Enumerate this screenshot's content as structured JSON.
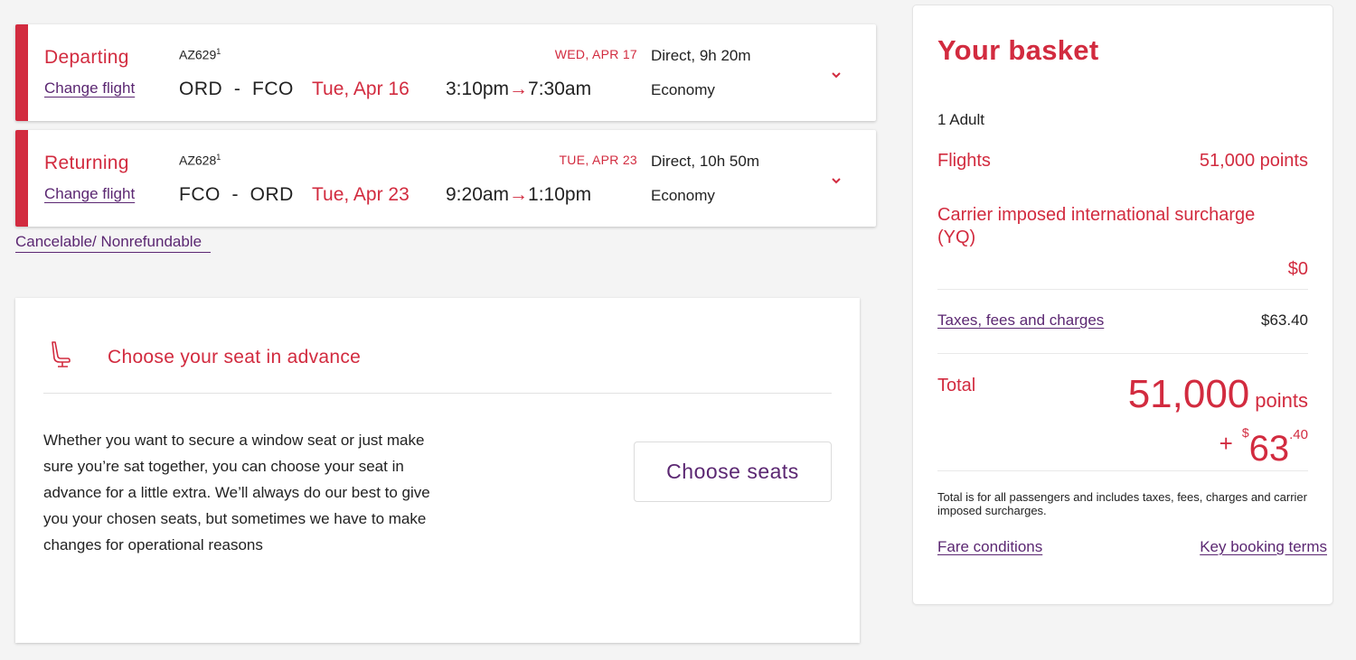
{
  "flights": [
    {
      "direction": "Departing",
      "change_label": "Change flight",
      "flight_number": "AZ629",
      "flight_note_marker": "1",
      "origin": "ORD",
      "destination": "FCO",
      "route_separator": "-",
      "departure_date": "Tue, Apr 16",
      "departure_time": "3:10pm",
      "arrival_time": "7:30am",
      "arrow": "→",
      "arrival_date": "WED, APR 17",
      "duration": "Direct, 9h 20m",
      "cabin": "Economy",
      "expand_icon": "chevron-down-icon"
    },
    {
      "direction": "Returning",
      "change_label": "Change flight",
      "flight_number": "AZ628",
      "flight_note_marker": "1",
      "origin": "FCO",
      "destination": "ORD",
      "route_separator": "-",
      "departure_date": "Tue, Apr 23",
      "departure_time": "9:20am",
      "arrival_time": "1:10pm",
      "arrow": "→",
      "arrival_date": "TUE, APR 23",
      "duration": "Direct, 10h 50m",
      "cabin": "Economy",
      "expand_icon": "chevron-down-icon"
    }
  ],
  "fare_policy_link": "Cancelable/ Nonrefundable",
  "seat_selection": {
    "icon": "seat-icon",
    "title": "Choose your seat in advance",
    "description": "Whether you want to secure a window seat or just make sure you’re sat together, you can choose your seat in advance for a little extra. We’ll always do our best to give you your chosen seats, but sometimes we have to make changes for operational reasons",
    "button_label": "Choose seats"
  },
  "basket": {
    "title": "Your basket",
    "passengers": "1 Adult",
    "flights_label": "Flights",
    "flights_value": "51,000 points",
    "surcharge_label": "Carrier imposed international surcharge (YQ)",
    "surcharge_value": "$0",
    "taxes_label": "Taxes, fees and charges",
    "taxes_value": "$63.40",
    "total_label": "Total",
    "total_points": "51,000",
    "total_points_unit": "points",
    "total_plus": "+",
    "total_currency": "$",
    "total_cash_whole": "63",
    "total_cash_cents": ".40",
    "note": "Total is for all passengers and includes taxes, fees, charges and carrier imposed surcharges.",
    "fare_conditions_link": "Fare conditions",
    "booking_terms_link": "Key booking terms"
  },
  "colors": {
    "brand_red": "#d22b3f",
    "link_purple": "#5b2772",
    "background": "#f4f4f4"
  }
}
